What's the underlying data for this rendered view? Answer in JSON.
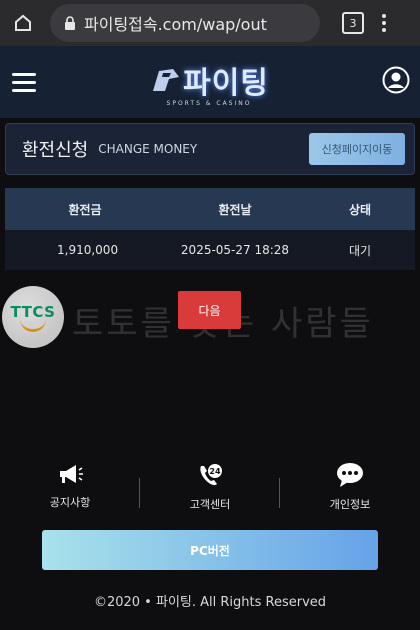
{
  "browser": {
    "url": "파이팅접속.com/wap/out",
    "tab_count": "3"
  },
  "header": {
    "logo_text": "파이팅",
    "logo_sub": "SPORTS & CASINO"
  },
  "title_bar": {
    "title_ko": "환전신청",
    "title_en": "CHANGE MONEY",
    "apply_button": "신청페이지이동"
  },
  "table": {
    "headers": [
      "환전금",
      "환전날",
      "상태"
    ],
    "rows": [
      {
        "amount": "1,910,000",
        "date": "2025-05-27 18:28",
        "status": "대기"
      }
    ]
  },
  "watermark": {
    "logo": "TTCS",
    "text": "토토를 찾는 사람들"
  },
  "next_button": "다음",
  "footer": {
    "links": [
      "공지사항",
      "고객센터",
      "개인정보"
    ],
    "support_badge": "24",
    "pc_button": "PC버전",
    "copyright": "©2020 • 파이팅. All Rights Reserved"
  },
  "colors": {
    "background": "#0e0e10",
    "header": "#162233",
    "accent_red": "#d93a3a",
    "table_head": "#263852"
  }
}
